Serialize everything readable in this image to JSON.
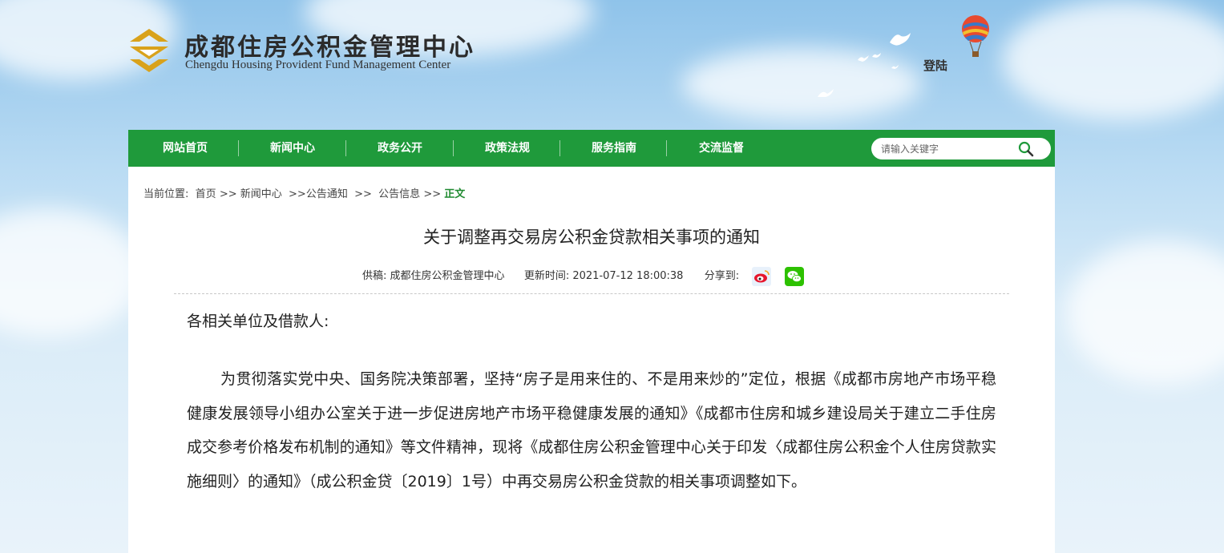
{
  "header": {
    "org_name_cn": "成都住房公积金管理中心",
    "org_name_en": "Chengdu Housing Provident Fund Management Center",
    "login_label": "登陆"
  },
  "nav": {
    "items": [
      {
        "label": "网站首页"
      },
      {
        "label": "新闻中心"
      },
      {
        "label": "政务公开"
      },
      {
        "label": "政策法规"
      },
      {
        "label": "服务指南"
      },
      {
        "label": "交流监督"
      }
    ],
    "search_placeholder": "请输入关键字"
  },
  "breadcrumb": {
    "prefix": "当前位置:",
    "home": "首页",
    "sep1": ">>",
    "news": "新闻中心",
    "sep2": ">>",
    "notice": "公告通知",
    "sep3": ">>",
    "info": "公告信息",
    "sep4": ">>",
    "current": "正文"
  },
  "article": {
    "title": "关于调整再交易房公积金贷款相关事项的通知",
    "source_label": "供稿:",
    "source": "成都住房公积金管理中心",
    "updated_label": "更新时间:",
    "updated": "2021-07-12 18:00:38",
    "share_label": "分享到:",
    "salutation": "各相关单位及借款人:",
    "paragraph": "为贯彻落实党中央、国务院决策部署，坚持“房子是用来住的、不是用来炒的”定位，根据《成都市房地产市场平稳健康发展领导小组办公室关于进一步促进房地产市场平稳健康发展的通知》《成都市住房和城乡建设局关于建立二手住房成交参考价格发布机制的通知》等文件精神，现将《成都住房公积金管理中心关于印发〈成都住房公积金个人住房贷款实施细则〉的通知》（成公积金贷〔2019〕1号）中再交易房公积金贷款的相关事项调整如下。"
  },
  "colors": {
    "nav_green": "#1f9a3b",
    "logo_gold": "#d9a21b",
    "crumb_current": "#1f8a30"
  },
  "icons": {
    "logo": "logo-icon",
    "balloon": "hot-air-balloon-icon",
    "birds": "doves-decoration-icon",
    "search": "search-icon",
    "weibo": "weibo-share-icon",
    "wechat": "wechat-share-icon"
  }
}
